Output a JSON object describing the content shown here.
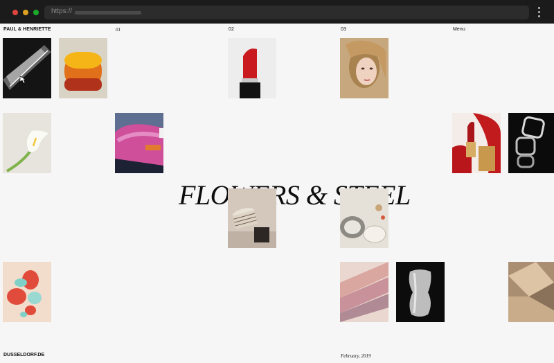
{
  "browser": {
    "url_prefix": "https://",
    "dots": [
      "#e0443e",
      "#dfa123",
      "#1aab29"
    ]
  },
  "header": {
    "brand": "PAUL & HENRIETTE",
    "col1": "01",
    "col2": "02",
    "col3": "03",
    "menu": "Menu"
  },
  "hero": {
    "title": "FLOWERS & STEEL"
  },
  "footer": {
    "site": "DUSSELDORF.DE",
    "date": "February, 2019"
  }
}
